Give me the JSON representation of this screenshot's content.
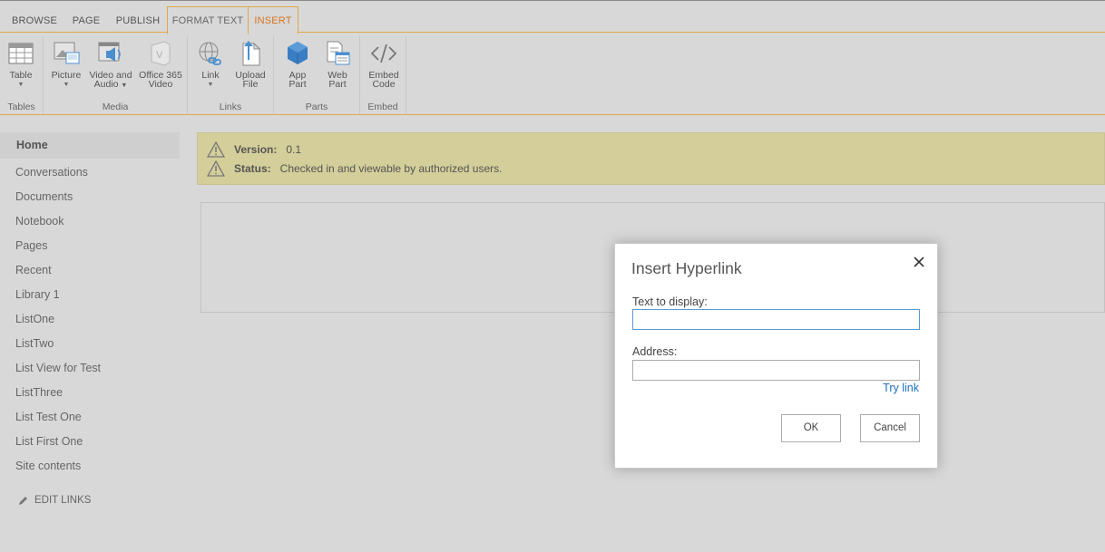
{
  "tabs": [
    "BROWSE",
    "PAGE",
    "PUBLISH",
    "FORMAT TEXT",
    "INSERT"
  ],
  "ribbon": {
    "groups": {
      "tables": "Tables",
      "media": "Media",
      "links": "Links",
      "parts": "Parts",
      "embed": "Embed"
    },
    "buttons": {
      "table": "Table",
      "picture": "Picture",
      "video_audio_1": "Video and",
      "video_audio_2": "Audio",
      "o365_1": "Office 365",
      "o365_2": "Video",
      "link": "Link",
      "upload_1": "Upload",
      "upload_2": "File",
      "app_1": "App",
      "app_2": "Part",
      "web_1": "Web",
      "web_2": "Part",
      "embed_1": "Embed",
      "embed_2": "Code"
    }
  },
  "nav": {
    "items": [
      "Home",
      "Conversations",
      "Documents",
      "Notebook",
      "Pages",
      "Recent",
      "Library 1",
      "ListOne",
      "ListTwo",
      "List View for Test",
      "ListThree",
      "List Test One",
      "List First One",
      "Site contents"
    ],
    "edit_links": "EDIT LINKS"
  },
  "status": {
    "version_label": "Version:",
    "version_value": "0.1",
    "status_label": "Status:",
    "status_value": "Checked in and viewable by authorized users."
  },
  "dialog": {
    "title": "Insert Hyperlink",
    "text_label": "Text to display:",
    "text_value": "",
    "address_label": "Address:",
    "address_value": "",
    "try_link": "Try link",
    "ok": "OK",
    "cancel": "Cancel"
  },
  "colors": {
    "accent": "#e0a84a",
    "insert_tab": "#d4731d",
    "link": "#1e6fbf",
    "status_bg": "#d4ce9a"
  }
}
